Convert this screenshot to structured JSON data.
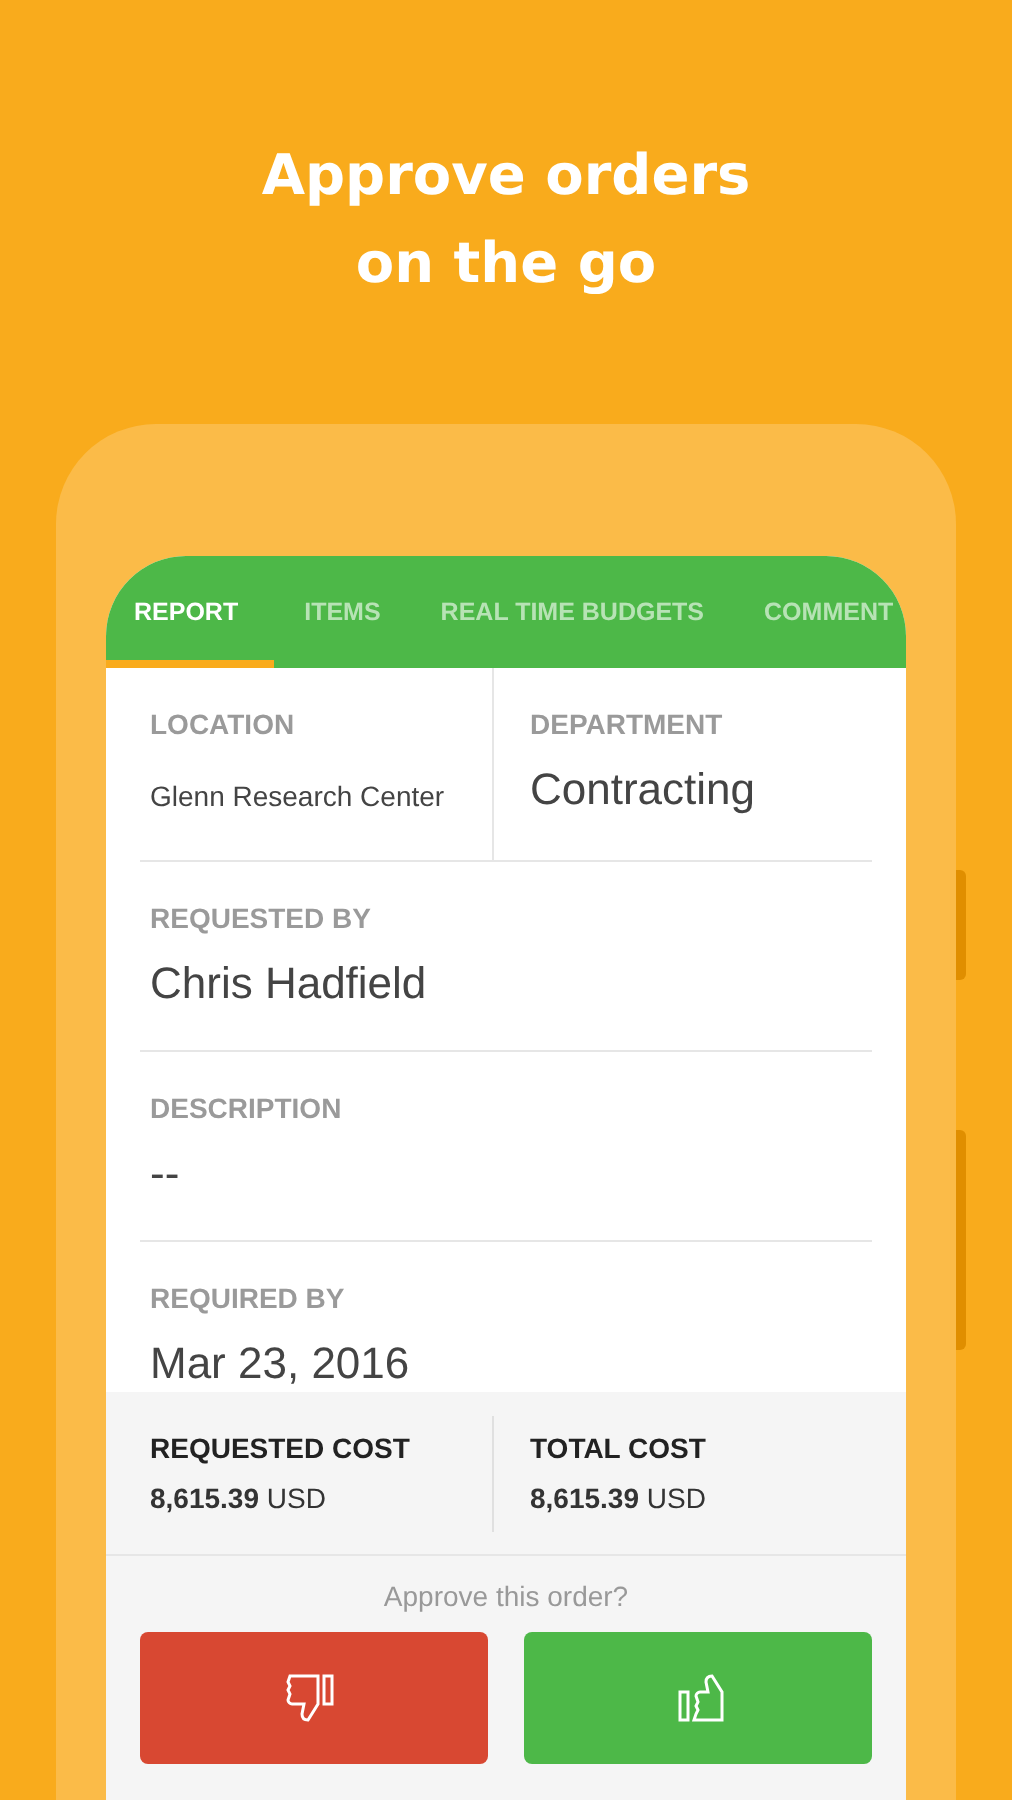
{
  "headline": [
    "Approve orders",
    "on the go"
  ],
  "tabs": [
    {
      "label": "REPORT",
      "selected": true
    },
    {
      "label": "ITEMS",
      "selected": false
    },
    {
      "label": "REAL TIME BUDGETS",
      "selected": false
    },
    {
      "label": "COMMENT",
      "selected": false
    }
  ],
  "fields": [
    {
      "kind": "pair",
      "items": [
        {
          "label": "LOCATION",
          "value": "Glenn Research Center",
          "kind": "small"
        },
        {
          "label": "DEPARTMENT",
          "value": "Contracting",
          "kind": "large"
        }
      ]
    },
    {
      "kind": "single",
      "items": [
        {
          "label": "REQUESTED BY",
          "value": "Chris Hadfield",
          "kind": "large"
        }
      ]
    },
    {
      "kind": "single",
      "items": [
        {
          "label": "DESCRIPTION",
          "value": "--",
          "kind": "large"
        }
      ]
    },
    {
      "kind": "single",
      "items": [
        {
          "label": "REQUIRED BY",
          "value": "Mar 23, 2016",
          "kind": "large"
        }
      ]
    }
  ],
  "costs": [
    {
      "label": "REQUESTED COST",
      "value": "**8,615.39** USD"
    },
    {
      "label": "TOTAL COST",
      "value": "**8,615.39** USD"
    }
  ],
  "prompt": "Approve this order?",
  "actions": [
    {
      "kind": "reject"
    },
    {
      "kind": "approve"
    }
  ]
}
